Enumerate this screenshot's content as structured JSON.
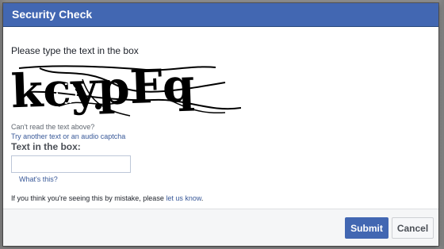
{
  "dialog": {
    "title": "Security Check"
  },
  "captcha": {
    "instruction": "Please type the text in the box",
    "image_text": "kcypFq",
    "cant_read": "Can't read the text above?",
    "try_another": "Try another text or an audio captcha",
    "field_label": "Text in the box:",
    "input_value": "",
    "input_placeholder": "",
    "whats_this": "What's this?"
  },
  "mistake": {
    "prefix": "If you think you're seeing this by mistake, please ",
    "link": "let us know",
    "suffix": "."
  },
  "footer": {
    "submit_label": "Submit",
    "cancel_label": "Cancel"
  },
  "colors": {
    "brand": "#4267b2",
    "link": "#385898",
    "footer_bg": "#f5f6f7"
  }
}
